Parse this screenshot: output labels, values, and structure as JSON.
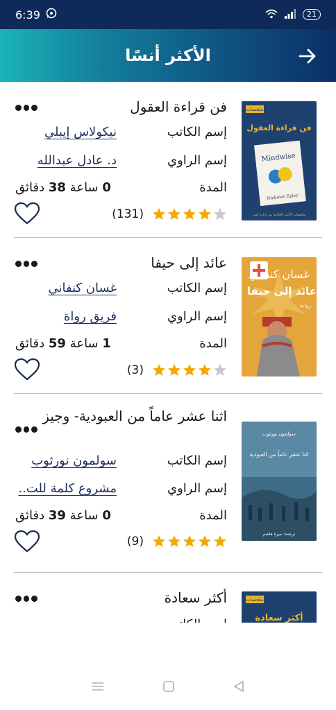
{
  "status_bar": {
    "time": "6:39",
    "battery": "21"
  },
  "header": {
    "title": "الأكثر أنسًا"
  },
  "labels": {
    "author": "إسم الكاتب",
    "narrator": "إسم الراوي",
    "duration": "المدة"
  },
  "books": [
    {
      "title": "فن قراءة العقول",
      "author": "نيكولاس إيبلي",
      "narrator": "د. عادل عبدالله",
      "duration_hours": "0",
      "duration_hours_unit": "ساعة",
      "duration_minutes": "38",
      "duration_minutes_unit": "دقائق",
      "rating": 4,
      "rating_count": "(131)",
      "cover": {
        "top_label": "ملخصات",
        "title": "فن قراءة العقول",
        "subtitle": "Mindwise",
        "author": "Nicholas Epley",
        "footer": "ملخصات لأكتب العلامة من إدارة كتب"
      }
    },
    {
      "title": "عائد إلى حيفا",
      "author": "غسان كنفاني",
      "narrator": "فريق رواة",
      "duration_hours": "1",
      "duration_hours_unit": "ساعة",
      "duration_minutes": "59",
      "duration_minutes_unit": "دقائق",
      "rating": 4,
      "rating_count": "(3)",
      "cover": {
        "top_label": "غسان كنفاني",
        "title": "عائد إلى حيفا",
        "subtitle": "رواية"
      }
    },
    {
      "title": "اثنا عشر عاماً من العبودية- وجيز",
      "author": "سولمون نورثوب",
      "narrator": "مشروع كلمة للت..",
      "duration_hours": "0",
      "duration_hours_unit": "ساعة",
      "duration_minutes": "39",
      "duration_minutes_unit": "دقائق",
      "rating": 5,
      "rating_count": "(9)",
      "cover": {
        "top_label": "سولمون نورثوب",
        "title": "اثنا عشر عاماً من العبودية",
        "footer": "ترجمة: ميرة هاشم"
      }
    },
    {
      "title": "أكثر سعادة",
      "cover": {
        "top_label": "ملخصات",
        "title": "أكثر سعادة"
      }
    }
  ],
  "colors": {
    "header_dark": "#0c2f66",
    "header_light": "#1bb3b8",
    "star": "#f2a900",
    "star_empty": "#c8c8c8",
    "link": "#1c2f5e"
  }
}
